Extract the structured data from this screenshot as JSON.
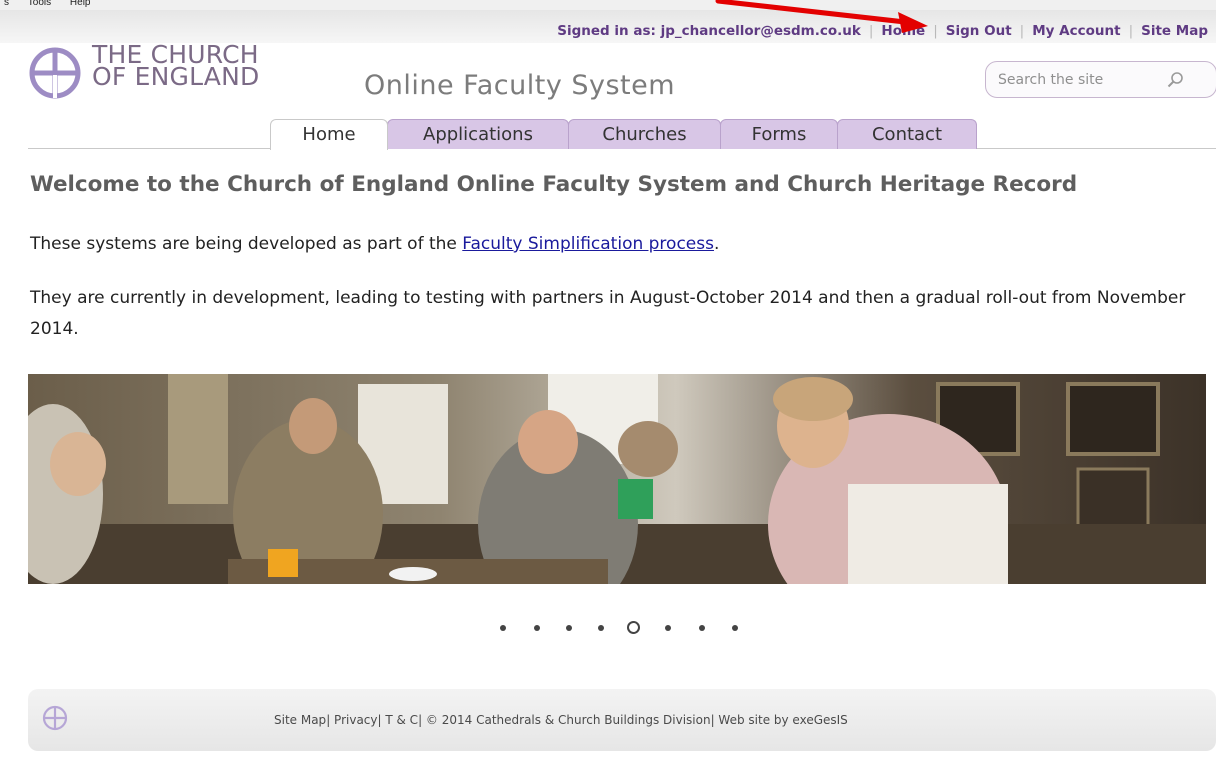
{
  "browser_menu": {
    "items": [
      "s",
      "Tools",
      "Help"
    ]
  },
  "user_bar": {
    "signed_in": "Signed in as: jp_chancellor@esdm.co.uk",
    "links": [
      "Home",
      "Sign Out",
      "My Account",
      "Site Map"
    ]
  },
  "brand": {
    "line1": "THE CHURCH",
    "line2": "OF ENGLAND",
    "site_title": "Online Faculty System"
  },
  "search": {
    "placeholder": "Search the site",
    "icon": "search-icon"
  },
  "tabs": [
    {
      "label": "Home",
      "active": true
    },
    {
      "label": "Applications",
      "active": false
    },
    {
      "label": "Churches",
      "active": false
    },
    {
      "label": "Forms",
      "active": false
    },
    {
      "label": "Contact",
      "active": false
    }
  ],
  "main": {
    "heading": "Welcome to the Church of England Online Faculty System and Church Heritage Record",
    "p1_before": "These systems are being developed as part of the ",
    "p1_link": "Faculty Simplification process",
    "p1_after": ".",
    "p2": "They are currently in development, leading to testing with partners in August-October 2014 and then a gradual roll-out from November 2014."
  },
  "carousel": {
    "slide_count": 8,
    "active_index": 4
  },
  "footer": {
    "links": [
      "Site Map",
      "Privacy",
      "T & C"
    ],
    "copyright": "© 2014 Cathedrals & Church Buildings Division",
    "credit": "Web site by exeGesIS"
  },
  "colors": {
    "brand_purple": "#5f3b83",
    "tab_purple": "#d8c6e6",
    "logo_lavender": "#9d8cc4",
    "annotation_red": "#e30000"
  }
}
